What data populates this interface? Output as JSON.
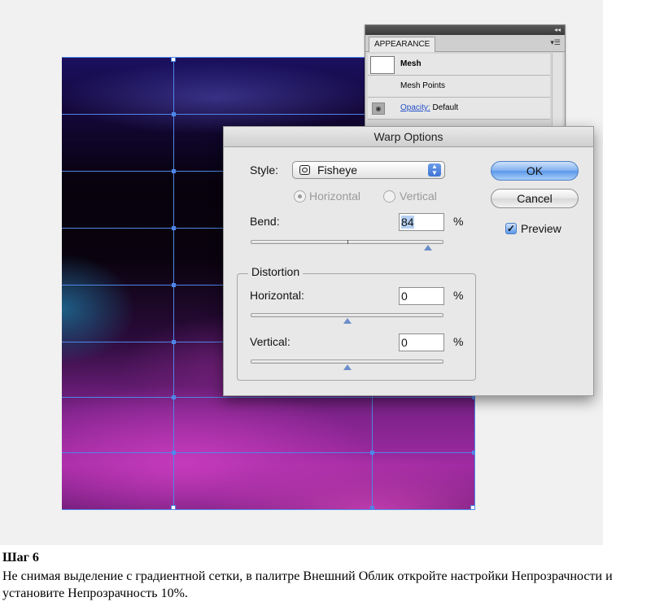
{
  "appearance_panel": {
    "tab_label": "APPEARANCE",
    "rows": [
      {
        "label": "Mesh"
      },
      {
        "label": "Mesh Points"
      },
      {
        "link_label": "Opacity:",
        "value": "Default"
      }
    ]
  },
  "warp_dialog": {
    "title": "Warp Options",
    "style_label": "Style:",
    "style_value": "Fisheye",
    "orientation_options": [
      "Horizontal",
      "Vertical"
    ],
    "orientation_selected": "Horizontal",
    "bend_label": "Bend:",
    "bend_value": "84",
    "bend_percent": 84,
    "percent_sign": "%",
    "distortion_group_label": "Distortion",
    "horizontal_label": "Horizontal:",
    "horizontal_value": "0",
    "horizontal_percent": 0,
    "vertical_label": "Vertical:",
    "vertical_value": "0",
    "vertical_percent": 0,
    "ok_label": "OK",
    "cancel_label": "Cancel",
    "preview_label": "Preview",
    "preview_checked": true
  },
  "caption": {
    "step_title": "Шаг 6",
    "step_text": "Не снимая выделение с градиентной сетки, в палитре Внешний Облик откройте настройки Непрозрачности и установите Непрозрачность 10%."
  },
  "icons": {
    "appearance_menu": "panel-menu-icon",
    "visibility": "eye-icon",
    "style": "fisheye-icon",
    "select_arrows": "stepper-arrows-icon",
    "preview_check": "checkmark-icon"
  },
  "colors": {
    "mesh_line": "#4f86e8",
    "ok_button": "#5a98ea",
    "link": "#2450c8"
  }
}
